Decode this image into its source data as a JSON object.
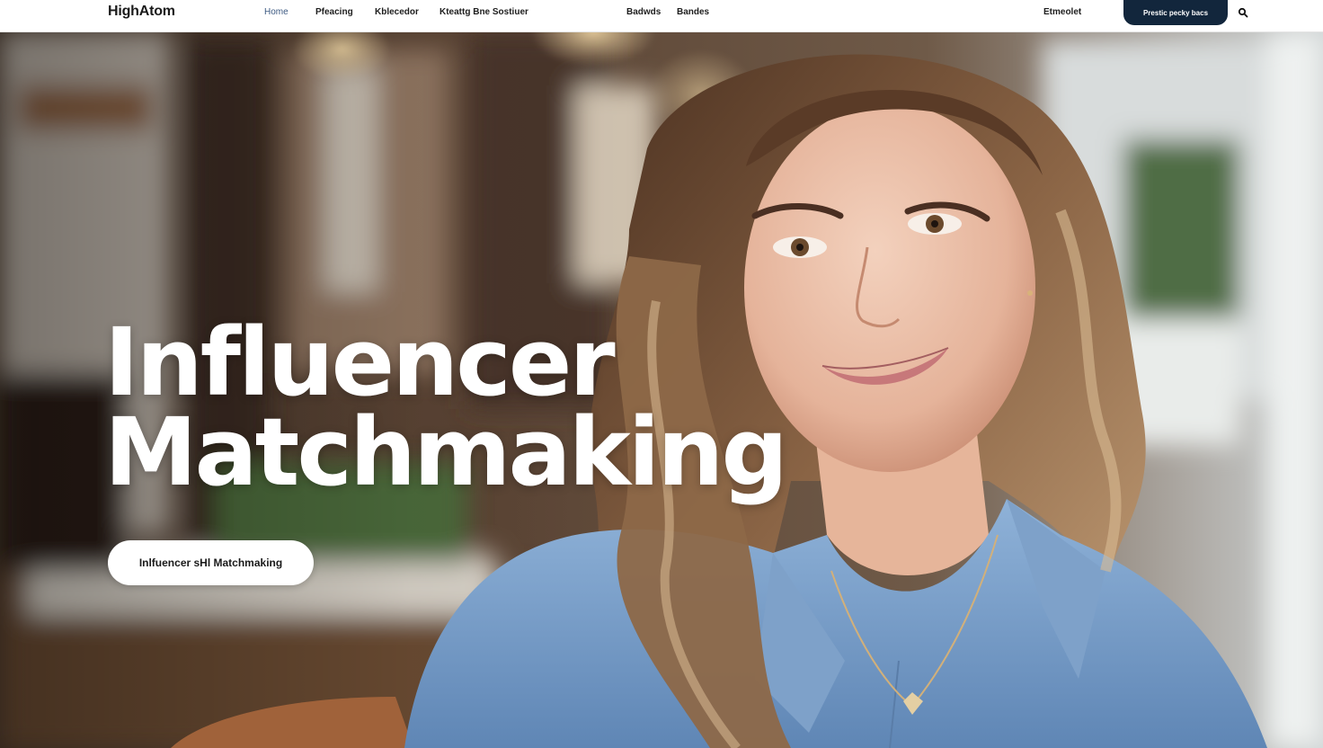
{
  "brand": {
    "logo_text": "HighAtom"
  },
  "nav": {
    "items": [
      {
        "label": "Home",
        "active": true
      },
      {
        "label": "Pfeacing"
      },
      {
        "label": "Kblecedor"
      },
      {
        "label": "Kteattg Bne Sostiuer"
      },
      {
        "label": "Badwds"
      },
      {
        "label": "Bandes"
      },
      {
        "label": "Etmeolet"
      }
    ],
    "cta_label": "Prestic pecky bacs",
    "search_icon": "search-icon"
  },
  "hero": {
    "title_line1": "Influencer",
    "title_line2": "Matchmaking",
    "pill_label": "Inlfuencer sHl Matchmaking"
  },
  "colors": {
    "nav_bg": "#ffffff",
    "cta_bg": "#12263c",
    "active_link": "#3d5a82",
    "hero_text": "#ffffff",
    "denim": "#6f96c4",
    "hair": "#6b4a33"
  }
}
